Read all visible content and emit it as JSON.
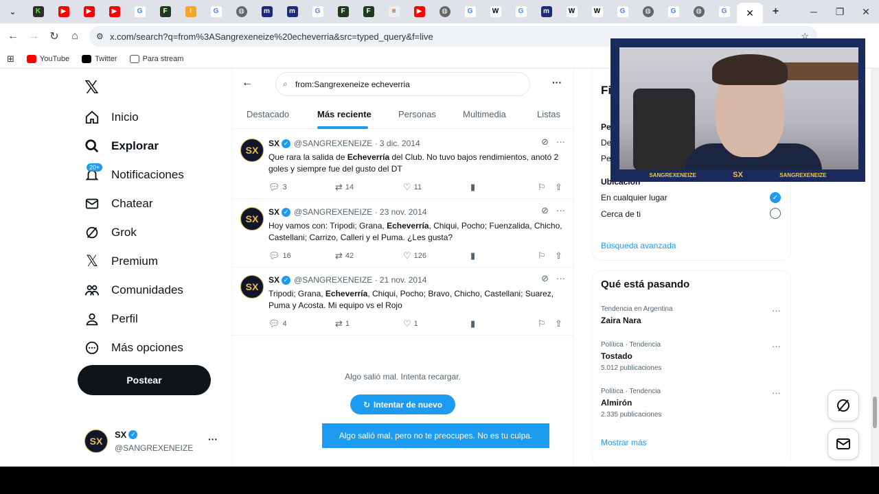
{
  "browser": {
    "url": "x.com/search?q=from%3ASangrexeneize%20echeverria&src=typed_query&f=live",
    "bookmarks": [
      "YouTube",
      "Twitter",
      "Para stream"
    ],
    "tab_close": "✕",
    "new_tab": "+"
  },
  "sidebar": {
    "items": [
      {
        "label": "Inicio",
        "icon": "home-icon"
      },
      {
        "label": "Explorar",
        "icon": "search-icon"
      },
      {
        "label": "Notificaciones",
        "icon": "bell-icon"
      },
      {
        "label": "Chatear",
        "icon": "mail-icon"
      },
      {
        "label": "Grok",
        "icon": "grok-icon"
      },
      {
        "label": "Premium",
        "icon": "x-icon"
      },
      {
        "label": "Comunidades",
        "icon": "people-icon"
      },
      {
        "label": "Perfil",
        "icon": "person-icon"
      },
      {
        "label": "Más opciones",
        "icon": "more-icon"
      }
    ],
    "notif_badge": "20+",
    "post_label": "Postear",
    "profile": {
      "name": "SX",
      "handle": "@SANGREXENEIZE",
      "avatar_text": "SX"
    }
  },
  "search": {
    "query": "from:Sangrexeneize echeverria",
    "tabs": [
      "Destacado",
      "Más reciente",
      "Personas",
      "Multimedia",
      "Listas"
    ],
    "active_tab": "Más reciente"
  },
  "tweets": [
    {
      "name": "SX",
      "handle": "@SANGREXENEIZE",
      "date": "· 3 dic. 2014",
      "text_before": "Que rara la salida de ",
      "highlight": "Echeverría",
      "text_after": " del Club. No tuvo bajos rendimientos, anotó 2 goles y siempre fue del gusto del DT",
      "replies": "3",
      "retweets": "14",
      "likes": "11"
    },
    {
      "name": "SX",
      "handle": "@SANGREXENEIZE",
      "date": "· 23 nov. 2014",
      "text_before": "Hoy vamos con: Tripodi; Grana, ",
      "highlight": "Echeverría",
      "text_after": ", Chiqui, Pocho; Fuenzalida, Chicho, Castellani; Carrizo, Calleri y el Puma. ¿Les gusta?",
      "replies": "16",
      "retweets": "42",
      "likes": "126"
    },
    {
      "name": "SX",
      "handle": "@SANGREXENEIZE",
      "date": "· 21 nov. 2014",
      "text_before": "Tripodi; Grana, ",
      "highlight": "Echeverría",
      "text_after": ", Chiqui, Pocho; Bravo, Chicho, Castellani; Suarez, Puma y Acosta. Mi equipo vs el Rojo",
      "replies": "4",
      "retweets": "1",
      "likes": "1"
    }
  ],
  "error": {
    "message": "Algo salió mal. Intenta recargar.",
    "retry_label": "Intentar de nuevo",
    "toast": "Algo salió mal, pero no te preocupes. No es tu culpa."
  },
  "filters": {
    "title": "Fi",
    "people_heading": "Pe",
    "people_opt1": "De",
    "people_opt2": "Pe",
    "location_heading": "Ubicación",
    "location_opt1": "En cualquier lugar",
    "location_opt2": "Cerca de ti",
    "advanced": "Búsqueda avanzada"
  },
  "trends": {
    "title": "Qué está pasando",
    "items": [
      {
        "meta": "Tendencia en Argentina",
        "name": "Zaira Nara",
        "count": ""
      },
      {
        "meta": "Política · Tendencia",
        "name": "Tostado",
        "count": "5.012 publicaciones"
      },
      {
        "meta": "Política · Tendencia",
        "name": "Almirón",
        "count": "2.335 publicaciones"
      }
    ],
    "show_more": "Mostrar más"
  },
  "webcam": {
    "labels": [
      "SANGREXENEIZE",
      "SX",
      "SANGREXENEIZE"
    ]
  },
  "colors": {
    "accent": "#1d9bf0",
    "text": "#0f1419",
    "muted": "#536471"
  }
}
